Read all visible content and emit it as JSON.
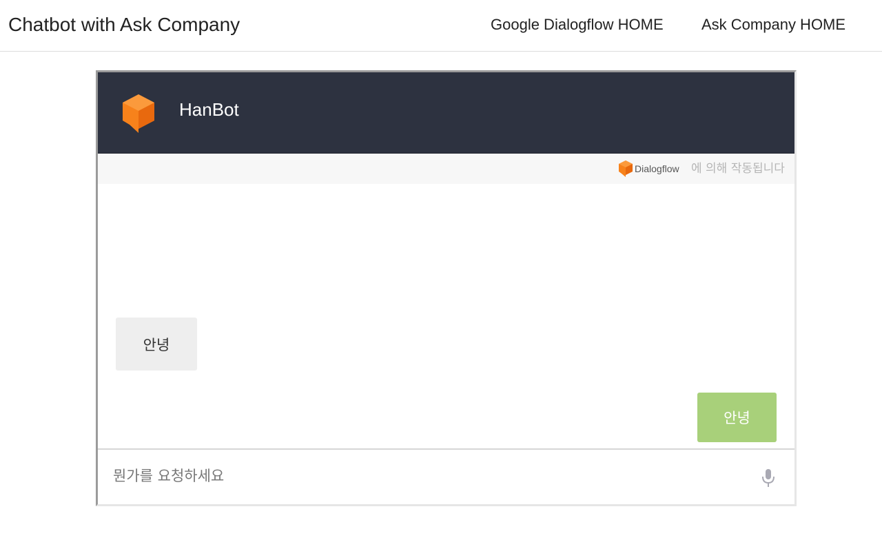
{
  "topbar": {
    "brand": "Chatbot with Ask Company",
    "links": [
      {
        "label": "Google Dialogflow HOME"
      },
      {
        "label": "Ask Company HOME"
      }
    ]
  },
  "chat": {
    "bot_name": "HanBot",
    "powered_by": {
      "brand": "Dialogflow",
      "suffix": "에 의해 작동됩니다"
    },
    "messages": [
      {
        "from": "bot",
        "text": "안녕"
      },
      {
        "from": "user",
        "text": "안녕"
      }
    ],
    "input": {
      "value": "",
      "placeholder": "뭔가를 요청하세요"
    },
    "colors": {
      "header_bg": "#2d3240",
      "user_bubble": "#a8d07a",
      "bot_bubble": "#eeeeee",
      "logo_orange": "#f7821b"
    },
    "icons": {
      "bot_logo": "dialogflow-logo-icon",
      "mic": "microphone-icon"
    }
  }
}
